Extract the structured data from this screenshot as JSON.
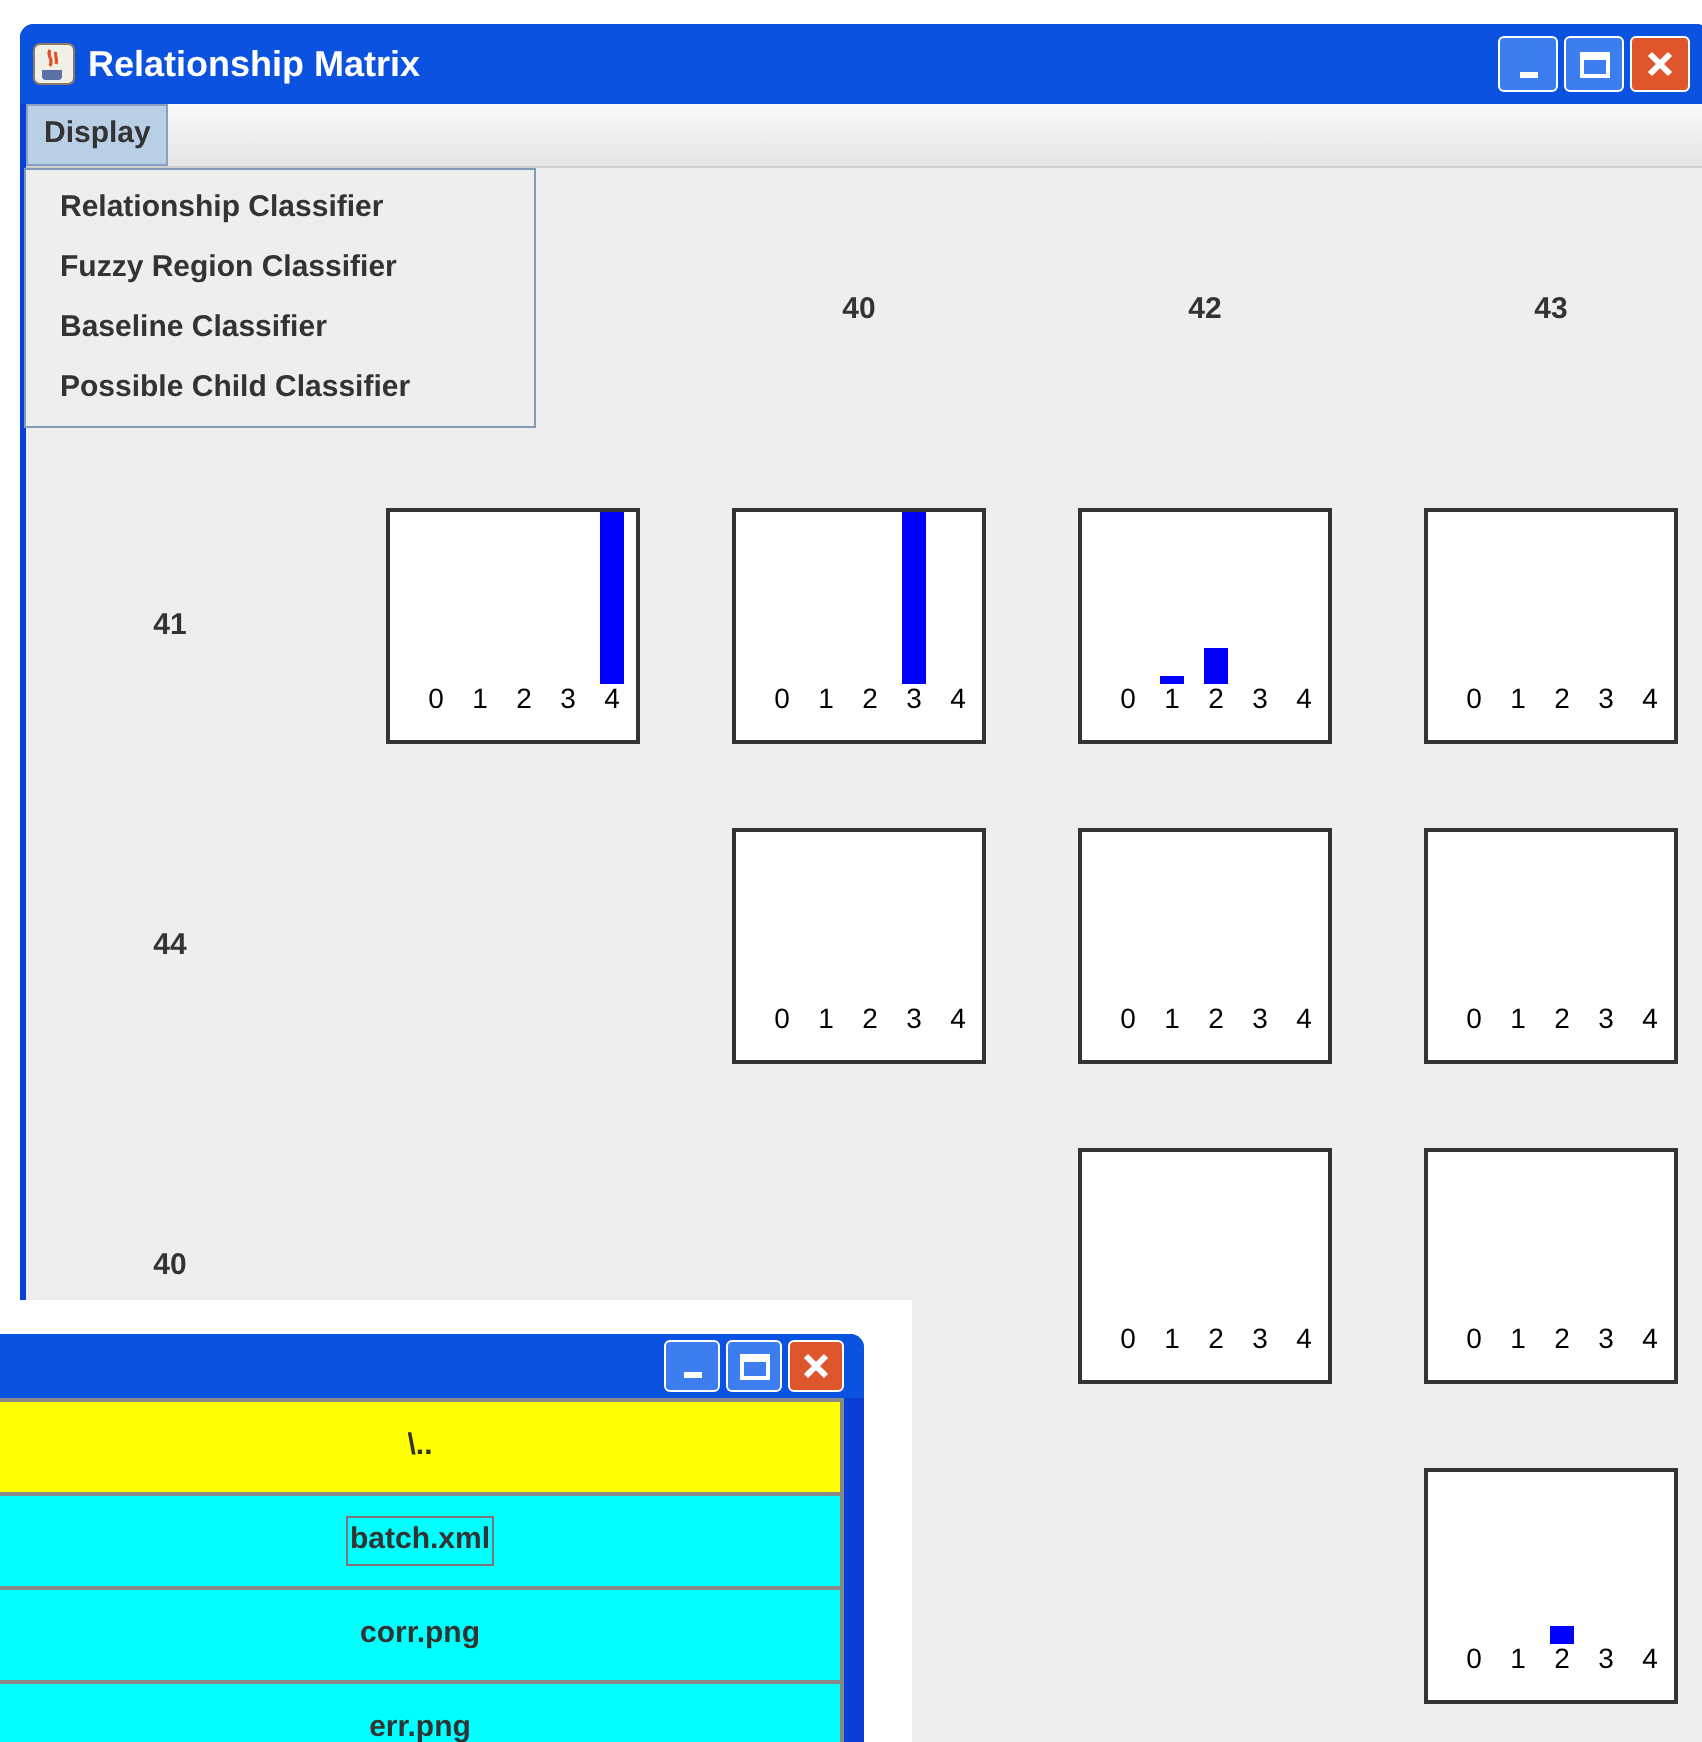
{
  "window": {
    "title": "Relationship Matrix"
  },
  "menu_bar": [
    {
      "label": "Display",
      "selected": true
    }
  ],
  "menu": {
    "items": [
      "Relationship Classifier",
      "Fuzzy Region Classifier",
      "Baseline Classifier",
      "Possible Child Classifier"
    ]
  },
  "matrix": {
    "column_headers": [
      "40",
      "42",
      "43"
    ],
    "rows": [
      {
        "label": "41",
        "cells": [
          {
            "axis_labels": [
              "0",
              "1",
              "2",
              "3",
              "4"
            ]
          },
          {
            "axis_labels": [
              "0",
              "1",
              "2",
              "3",
              "4"
            ]
          },
          {
            "axis_labels": [
              "0",
              "1",
              "2",
              "3",
              "4"
            ]
          },
          {
            "axis_labels": [
              "0",
              "1",
              "2",
              "3",
              "4"
            ]
          }
        ]
      },
      {
        "label": "44",
        "cells": [
          null,
          {
            "axis_labels": [
              "0",
              "1",
              "2",
              "3",
              "4"
            ]
          },
          {
            "axis_labels": [
              "0",
              "1",
              "2",
              "3",
              "4"
            ]
          },
          {
            "axis_labels": [
              "0",
              "1",
              "2",
              "3",
              "4"
            ]
          }
        ]
      },
      {
        "label": "40",
        "cells": [
          null,
          null,
          {
            "axis_labels": [
              "0",
              "1",
              "2",
              "3",
              "4"
            ]
          },
          {
            "axis_labels": [
              "0",
              "1",
              "2",
              "3",
              "4"
            ]
          }
        ]
      },
      {
        "cells": [
          null,
          null,
          null,
          {
            "axis_labels": [
              "0",
              "1",
              "2",
              "3",
              "4"
            ]
          }
        ]
      }
    ]
  },
  "file_window": {
    "rows": [
      {
        "name": "\\..",
        "color": "#ffff00",
        "focused": false
      },
      {
        "name": "batch.xml",
        "color": "#00ffff",
        "focused": true
      },
      {
        "name": "corr.png",
        "color": "#00ffff",
        "focused": false
      },
      {
        "name": "err.png",
        "color": "#00ffff",
        "focused": false
      }
    ]
  }
}
